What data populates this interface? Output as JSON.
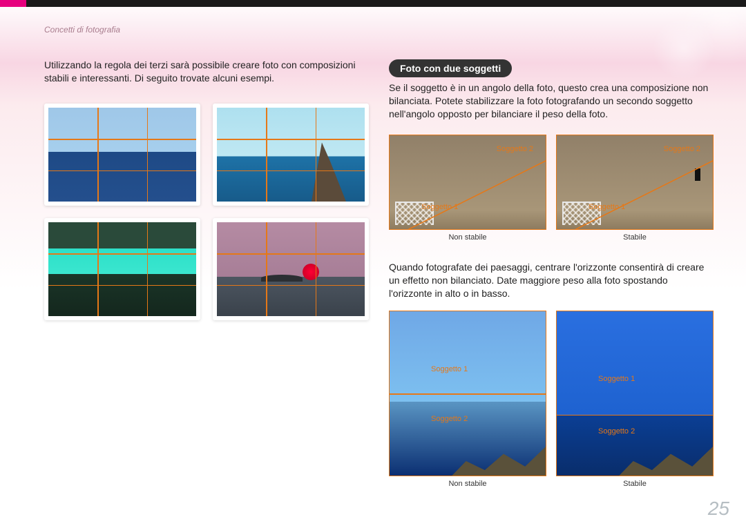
{
  "breadcrumb": "Concetti di fotografia",
  "intro": "Utilizzando la regola dei terzi sarà possibile creare foto con composizioni stabili e interessanti. Di seguito trovate alcuni esempi.",
  "section_title": "Foto con due soggetti",
  "right_p1": "Se il soggetto è in un angolo della foto, questo crea una composizione non bilanciata. Potete stabilizzare la foto fotografando un secondo soggetto nell'angolo opposto per bilanciare il peso della foto.",
  "right_p2": "Quando fotografate dei paesaggi, centrare l'orizzonte consentirà di creare un effetto non bilanciato. Date maggiore peso alla foto spostando l'orizzonte in alto o in basso.",
  "labels": {
    "subject1": "Soggetto 1",
    "subject2": "Soggetto 2",
    "unstable": "Non stabile",
    "stable": "Stabile"
  },
  "page_number": "25"
}
